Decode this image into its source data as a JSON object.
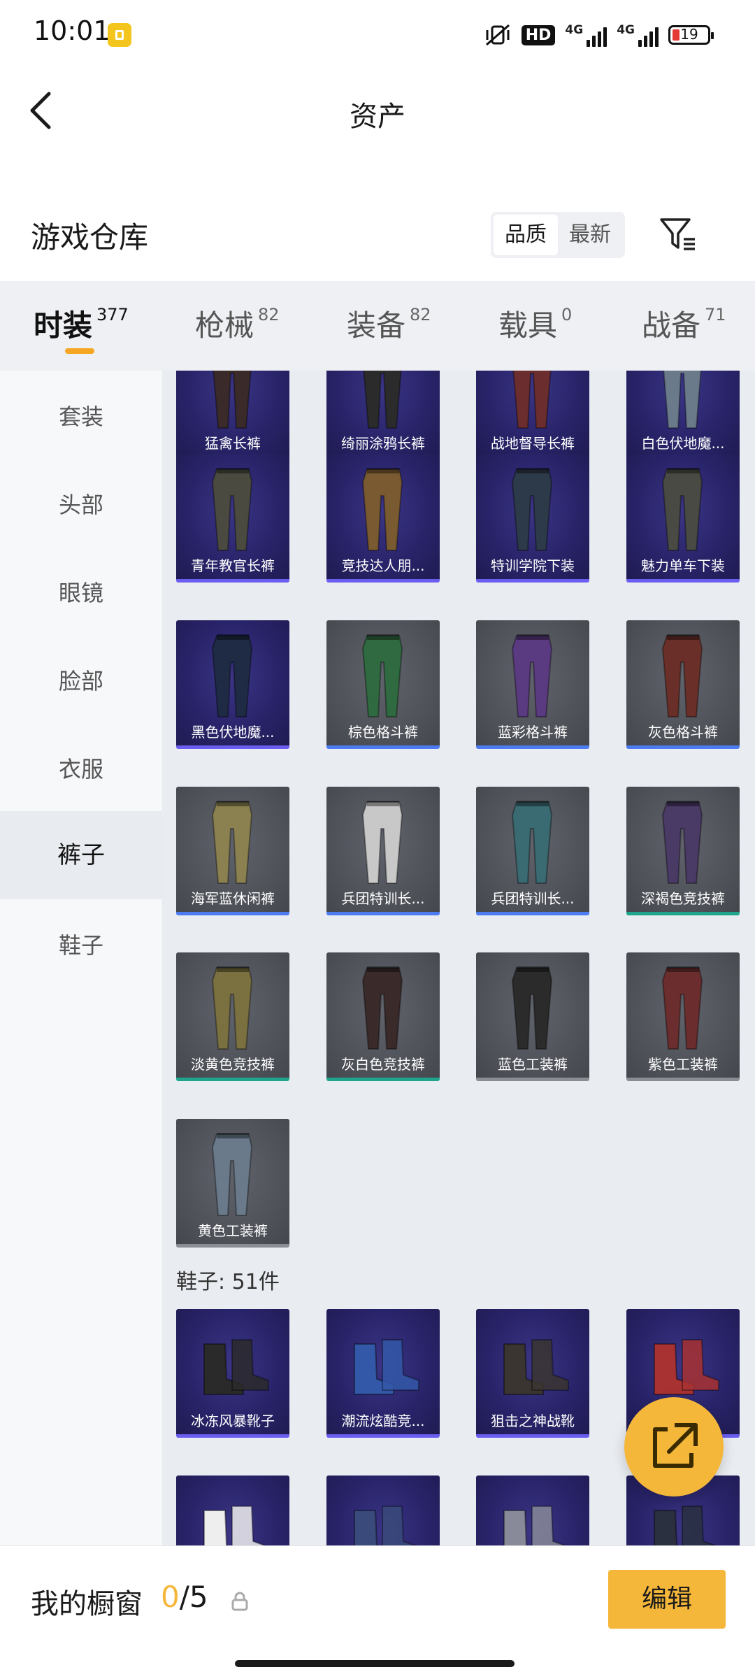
{
  "status_bar": {
    "time": "10:01",
    "hd_label": "HD",
    "net1": "4G",
    "net2": "4G",
    "battery": "19"
  },
  "header": {
    "title": "资产"
  },
  "warehouse": {
    "title": "游戏仓库",
    "sort_options": [
      "品质",
      "最新"
    ],
    "sort_active": "品质"
  },
  "category_tabs": [
    {
      "name": "时装",
      "count": "377",
      "active": true
    },
    {
      "name": "枪械",
      "count": "82",
      "active": false
    },
    {
      "name": "装备",
      "count": "82",
      "active": false
    },
    {
      "name": "载具",
      "count": "0",
      "active": false
    },
    {
      "name": "战备",
      "count": "71",
      "active": false
    }
  ],
  "sidebar": {
    "items": [
      {
        "label": "套装",
        "active": false
      },
      {
        "label": "头部",
        "active": false
      },
      {
        "label": "眼镜",
        "active": false
      },
      {
        "label": "脸部",
        "active": false
      },
      {
        "label": "衣服",
        "active": false
      },
      {
        "label": "裤子",
        "active": true
      },
      {
        "label": "鞋子",
        "active": false
      }
    ]
  },
  "pants_items": [
    {
      "label": "猛禽长裤",
      "quality": "purple"
    },
    {
      "label": "绮丽涂鸦长裤",
      "quality": "purple"
    },
    {
      "label": "战地督导长裤",
      "quality": "purple"
    },
    {
      "label": "白色伏地魔...",
      "quality": "purple"
    },
    {
      "label": "青年教官长裤",
      "quality": "purple"
    },
    {
      "label": "竞技达人朋...",
      "quality": "purple"
    },
    {
      "label": "特训学院下装",
      "quality": "purple"
    },
    {
      "label": "魅力单车下装",
      "quality": "purple"
    },
    {
      "label": "黑色伏地魔...",
      "quality": "purple"
    },
    {
      "label": "棕色格斗裤",
      "quality": "blue"
    },
    {
      "label": "蓝彩格斗裤",
      "quality": "blue"
    },
    {
      "label": "灰色格斗裤",
      "quality": "blue"
    },
    {
      "label": "海军蓝休闲裤",
      "quality": "blue"
    },
    {
      "label": "兵团特训长...",
      "quality": "blue"
    },
    {
      "label": "兵团特训长...",
      "quality": "blue"
    },
    {
      "label": "深褐色竞技裤",
      "quality": "teal"
    },
    {
      "label": "淡黄色竞技裤",
      "quality": "teal"
    },
    {
      "label": "灰白色竞技裤",
      "quality": "teal"
    },
    {
      "label": "蓝色工装裤",
      "quality": "gray"
    },
    {
      "label": "紫色工装裤",
      "quality": "gray"
    },
    {
      "label": "黄色工装裤",
      "quality": "gray"
    }
  ],
  "shoes_section": {
    "label": "鞋子: 51件"
  },
  "shoes_items": [
    {
      "label": "冰冻风暴靴子",
      "quality": "purple"
    },
    {
      "label": "潮流炫酷竞...",
      "quality": "purple"
    },
    {
      "label": "狙击之神战靴",
      "quality": "purple"
    },
    {
      "label": "",
      "quality": "purple"
    },
    {
      "label": "",
      "quality": "purple"
    },
    {
      "label": "",
      "quality": "purple"
    },
    {
      "label": "",
      "quality": "purple"
    },
    {
      "label": "",
      "quality": "purple"
    }
  ],
  "bottom_bar": {
    "showcase_label": "我的橱窗",
    "showcase_current": "0",
    "showcase_total": "/5",
    "edit_label": "编辑"
  },
  "colors": {
    "accent": "#f5b73a",
    "purple_quality": "#6a5df0",
    "blue_quality": "#4d7cf2",
    "teal_quality": "#1fa58e",
    "gray_quality": "#8a8d92"
  },
  "icons": {
    "back": "chevron-left-icon",
    "filter": "filter-icon",
    "share": "external-link-icon",
    "lock": "lock-icon",
    "mute": "vibrate-mute-icon"
  }
}
